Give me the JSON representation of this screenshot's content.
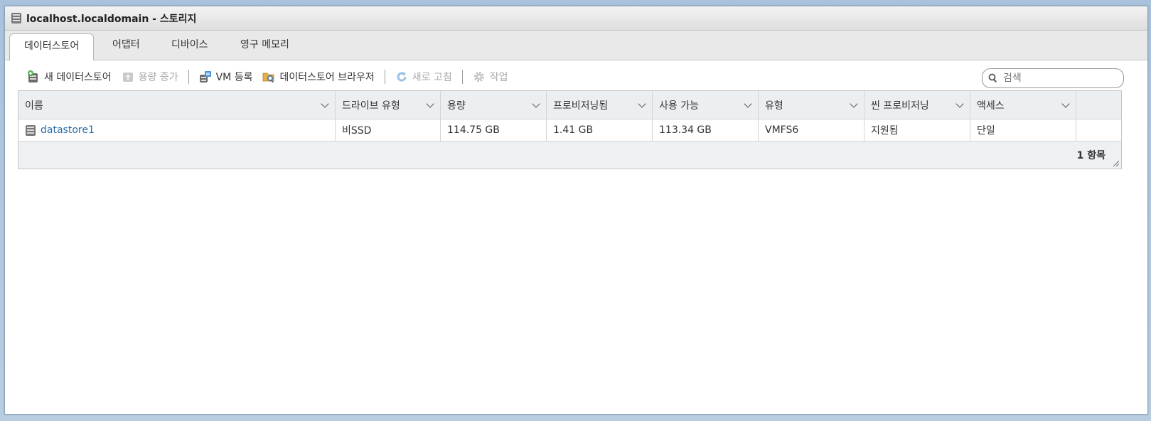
{
  "window": {
    "title": "localhost.localdomain - 스토리지"
  },
  "tabs": [
    {
      "label": "데이터스토어",
      "active": true
    },
    {
      "label": "어댑터",
      "active": false
    },
    {
      "label": "디바이스",
      "active": false
    },
    {
      "label": "영구 메모리",
      "active": false
    }
  ],
  "toolbar": {
    "new_datastore": "새 데이터스토어",
    "increase_capacity": "용량 증가",
    "register_vm": "VM 등록",
    "datastore_browser": "데이터스토어 브라우저",
    "refresh": "새로 고침",
    "actions": "작업"
  },
  "search": {
    "placeholder": "검색"
  },
  "table": {
    "columns": [
      "이름",
      "드라이브 유형",
      "용량",
      "프로비저닝됨",
      "사용 가능",
      "유형",
      "씬 프로비저닝",
      "액세스"
    ],
    "rows": [
      [
        "datastore1",
        "비SSD",
        "114.75 GB",
        "1.41 GB",
        "113.34 GB",
        "VMFS6",
        "지원됨",
        "단일"
      ]
    ],
    "footer": "1 항목"
  },
  "colors": {
    "link": "#2b6aa6",
    "accent": "#3d7ab8"
  }
}
